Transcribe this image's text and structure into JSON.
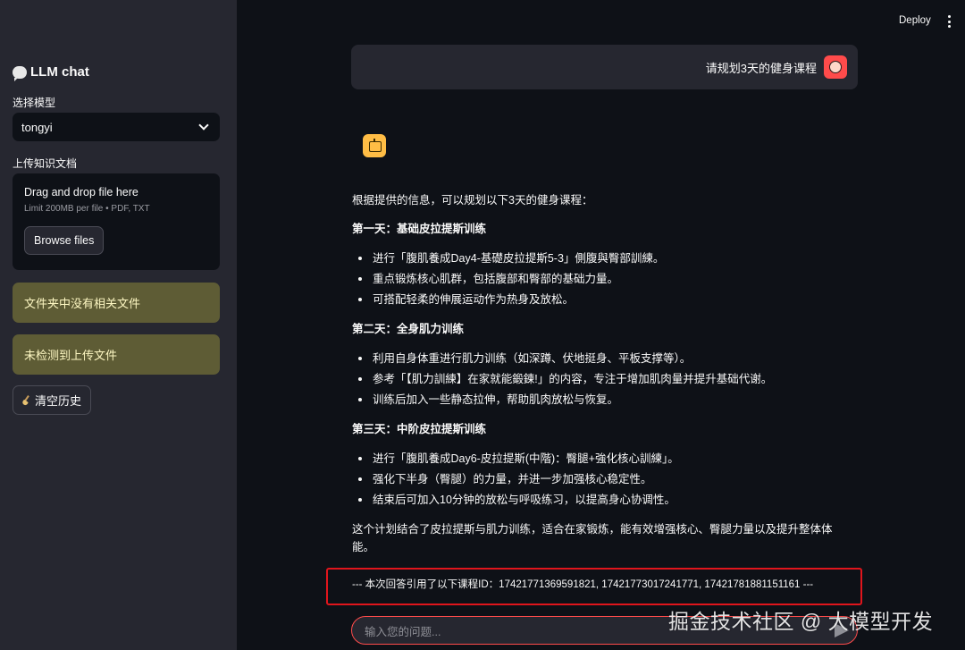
{
  "header": {
    "deploy_label": "Deploy"
  },
  "sidebar": {
    "title": "LLM chat",
    "model_label": "选择模型",
    "model_value": "tongyi",
    "upload_label": "上传知识文档",
    "upload_title": "Drag and drop file here",
    "upload_limit": "Limit 200MB per file • PDF, TXT",
    "browse_label": "Browse files",
    "warning_1": "文件夹中没有相关文件",
    "warning_2": "未检测到上传文件",
    "clear_label": "清空历史"
  },
  "chat": {
    "user_message": "请规划3天的健身课程",
    "intro": "根据提供的信息，可以规划以下3天的健身课程：",
    "days": [
      {
        "title": "第一天：基础皮拉提斯训练",
        "items": [
          "进行「腹肌養成Day4-基礎皮拉提斯5-3」側腹與臀部訓練。",
          "重点锻炼核心肌群，包括腹部和臀部的基础力量。",
          "可搭配轻柔的伸展运动作为热身及放松。"
        ]
      },
      {
        "title": "第二天：全身肌力训练",
        "items": [
          "利用自身体重进行肌力训练（如深蹲、伏地挺身、平板支撑等）。",
          "参考「【肌力訓練】在家就能鍛鍊!」的内容，专注于增加肌肉量并提升基础代谢。",
          "训练后加入一些静态拉伸，帮助肌肉放松与恢复。"
        ]
      },
      {
        "title": "第三天：中阶皮拉提斯训练",
        "items": [
          "进行「腹肌養成Day6-皮拉提斯(中階)：臀腿+強化核心訓練」。",
          "强化下半身（臀腿）的力量，并进一步加强核心稳定性。",
          "结束后可加入10分钟的放松与呼吸练习，以提高身心协调性。"
        ]
      }
    ],
    "summary": "这个计划结合了皮拉提斯与肌力训练，适合在家锻炼，能有效增强核心、臀腿力量以及提升整体体能。",
    "reference": "--- 本次回答引用了以下课程ID：17421771369591821, 17421773017241771, 17421781881151161 ---",
    "input_placeholder": "输入您的问题..."
  },
  "watermark": "掘金技术社区 @ 大模型开发"
}
